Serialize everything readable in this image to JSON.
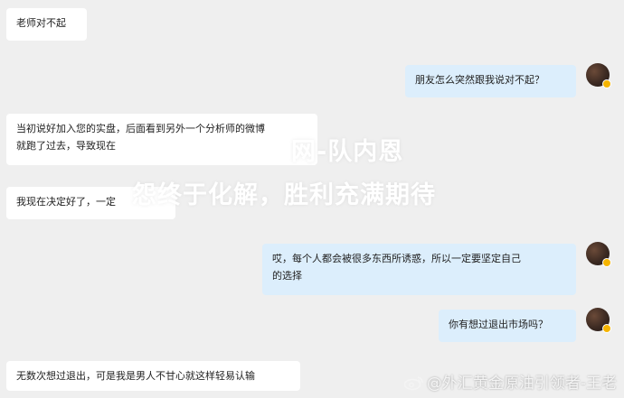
{
  "messages": [
    {
      "side": "left",
      "text": "老师对不起"
    },
    {
      "side": "right",
      "text": "朋友怎么突然跟我说对不起？"
    },
    {
      "side": "left",
      "text": "当初说好加入您的实盘，后面看到另外一个分析师的微博\n就跑了过去，导致现在"
    },
    {
      "side": "left",
      "text": "我现在决定好了，一定"
    },
    {
      "side": "right",
      "text": "哎，每个人都会被很多东西所诱惑，所以一定要坚定自己\n的选择"
    },
    {
      "side": "right",
      "text": "你有想过退出市场吗？"
    },
    {
      "side": "left",
      "text": "无数次想过退出，可是我是男人不甘心就这样轻易认输"
    }
  ],
  "overlay": {
    "line1": "网-队内恩",
    "line2": "怨终于化解，胜利充满期待"
  },
  "watermark": "@外汇黄金原油引领者-王老",
  "colors": {
    "background": "#efefef",
    "left_bubble": "#ffffff",
    "right_bubble": "#dceefc",
    "badge": "#f5b400"
  }
}
